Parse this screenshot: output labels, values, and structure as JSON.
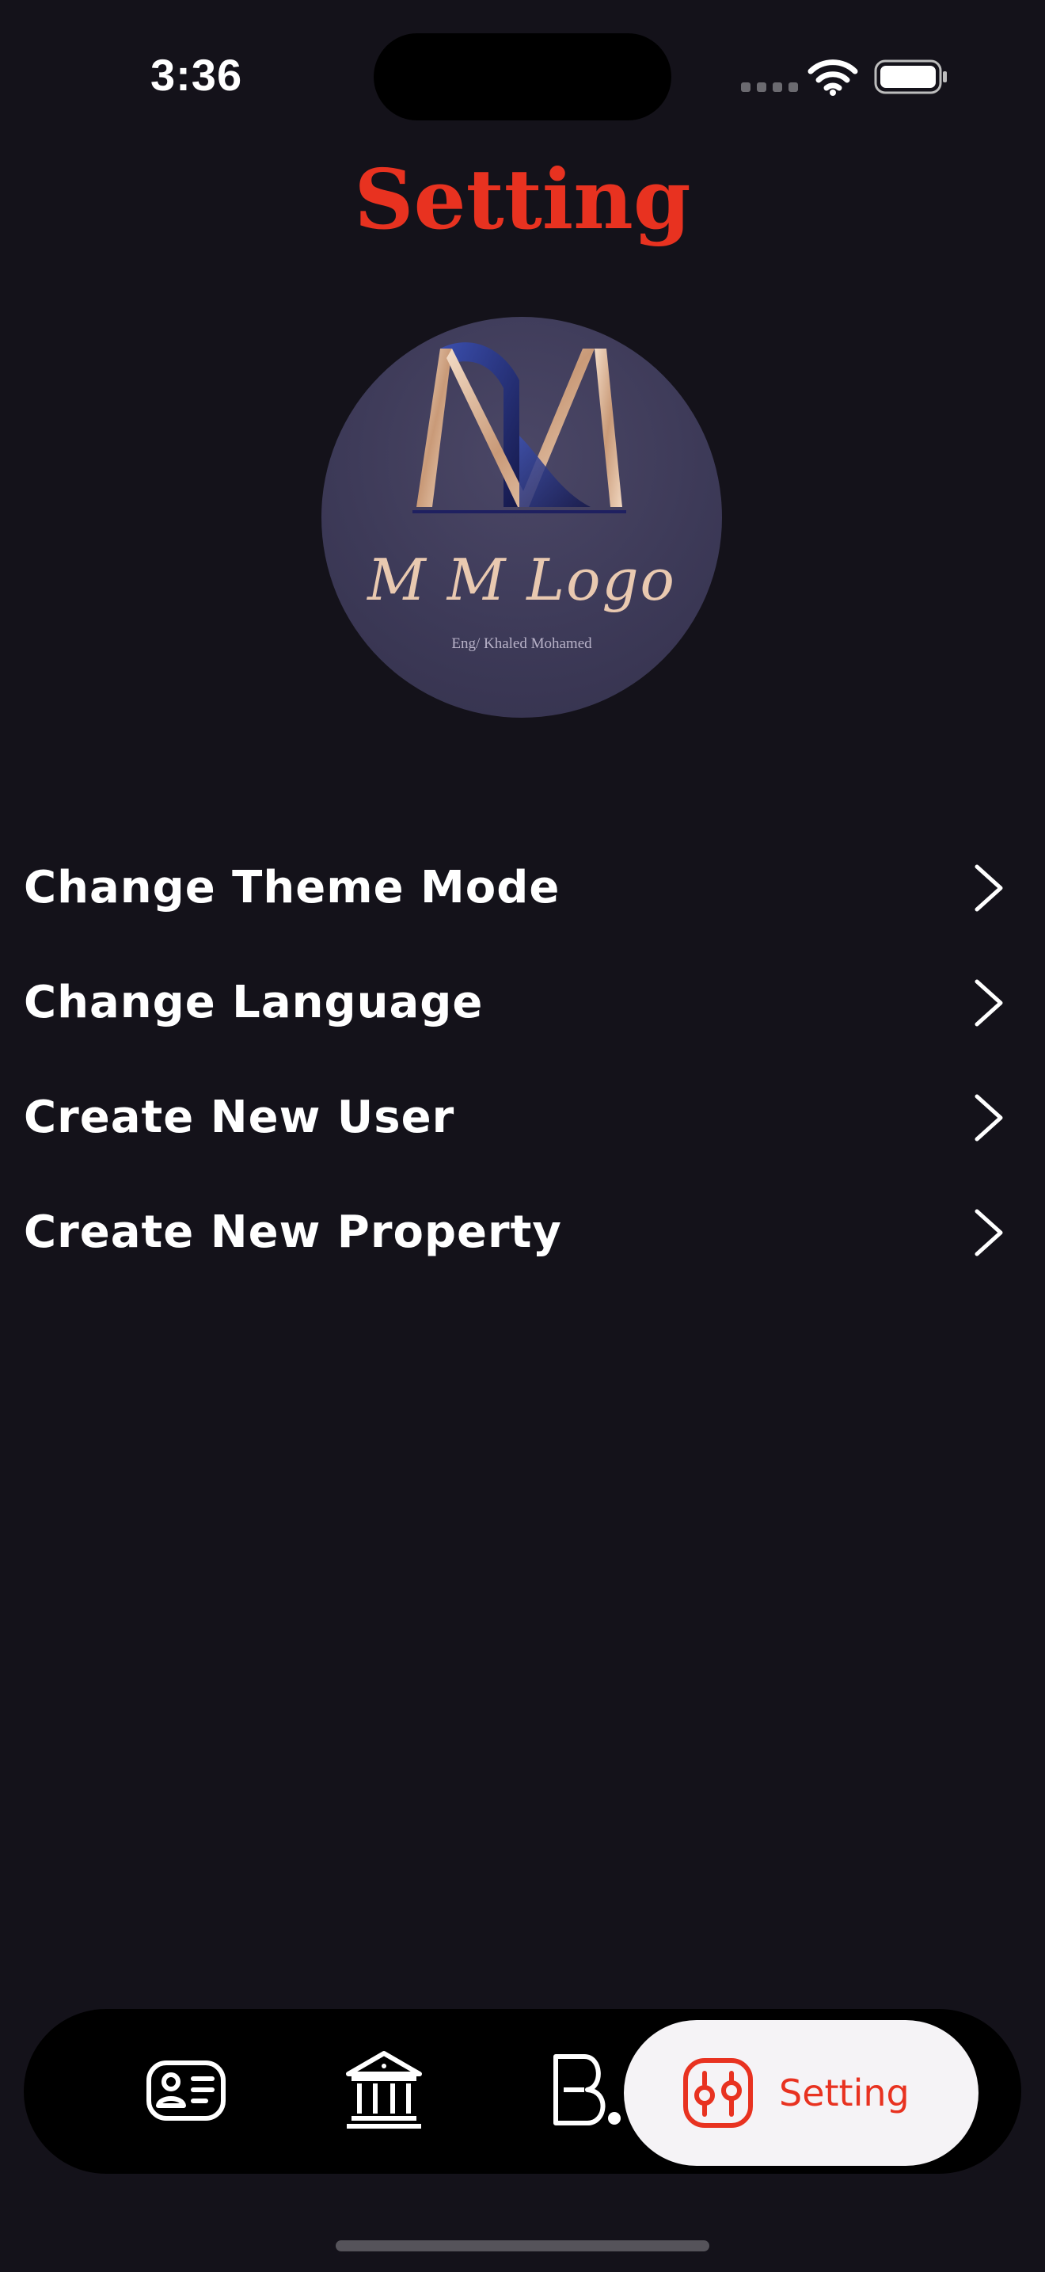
{
  "status_bar": {
    "time": "3:36",
    "icons": [
      "cellular-icon",
      "wifi-icon",
      "battery-icon"
    ]
  },
  "header": {
    "title": "Setting"
  },
  "logo": {
    "script_text": "M M Logo",
    "subtitle": "Eng/ Khaled Mohamed"
  },
  "menu": {
    "items": [
      {
        "label": "Change Theme Mode",
        "icon": "chevron-right-icon"
      },
      {
        "label": "Change Language",
        "icon": "chevron-right-icon"
      },
      {
        "label": "Create New User",
        "icon": "chevron-right-icon"
      },
      {
        "label": "Create New Property",
        "icon": "chevron-right-icon"
      }
    ]
  },
  "bottom_nav": {
    "items": [
      {
        "icon": "profile-card-icon"
      },
      {
        "icon": "bank-icon"
      },
      {
        "icon": "b-letter-icon"
      },
      {
        "icon": "sliders-icon",
        "label": "Setting",
        "active": true
      }
    ]
  },
  "colors": {
    "background": "#14121a",
    "accent": "#e83220",
    "text": "#ffffff",
    "nav_background": "#000000",
    "nav_active_background": "#f5f3f6"
  }
}
